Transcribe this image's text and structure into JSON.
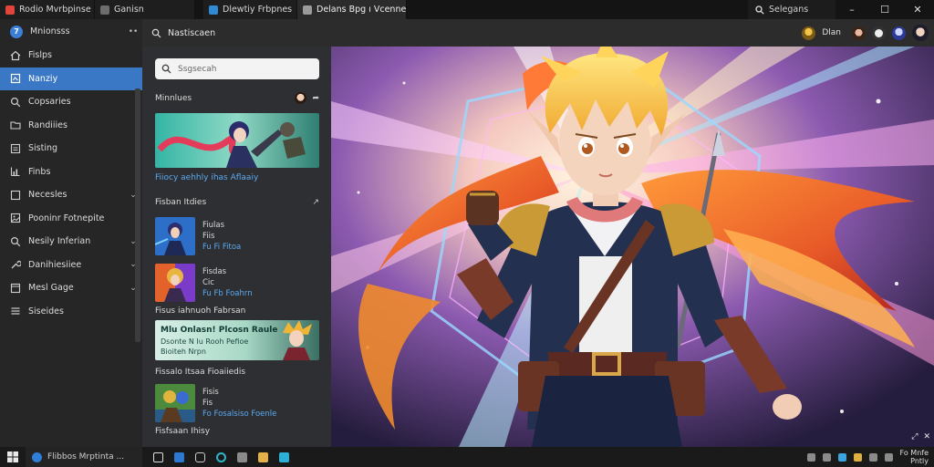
{
  "titlebar": {
    "tabs": [
      {
        "label": "Rodio Mvrbpinse",
        "color": "#e0443a"
      },
      {
        "label": "Ganisn",
        "color": "#6d6d6d"
      },
      {
        "label": "Dlewtiy Frbpnes",
        "color": "#2f8ad3"
      },
      {
        "label": "Delans Bpg ı Vcenne",
        "color": "#9a9a9a"
      }
    ],
    "search_label": "Selegans",
    "minimize": "–",
    "maximize": "☐",
    "close": "✕"
  },
  "sidebar": {
    "header": {
      "label": "Mnionsss",
      "avatar": "7"
    },
    "items": [
      {
        "label": "Fislps",
        "icon": "home-icon",
        "chevron": false
      },
      {
        "label": "Nanziy",
        "icon": "library-icon",
        "chevron": false,
        "active": true
      },
      {
        "label": "Copsaries",
        "icon": "search-icon",
        "chevron": false
      },
      {
        "label": "Randiiies",
        "icon": "folder-icon",
        "chevron": false
      },
      {
        "label": "Sisting",
        "icon": "list-icon",
        "chevron": false
      },
      {
        "label": "Finbs",
        "icon": "chart-icon",
        "chevron": false
      },
      {
        "label": "Necesles",
        "icon": "square-icon",
        "chevron": true
      },
      {
        "label": "Pooninr Fotnepite",
        "icon": "image-icon",
        "chevron": false
      },
      {
        "label": "Nesily Inferian",
        "icon": "search-icon",
        "chevron": true
      },
      {
        "label": "Danihiesiiee",
        "icon": "wrench-icon",
        "chevron": true
      },
      {
        "label": "Mesl Gage",
        "icon": "window-icon",
        "chevron": true
      },
      {
        "label": "Siseides",
        "icon": "menu-icon",
        "chevron": false
      }
    ]
  },
  "toolbar": {
    "back_label": "Nastiscaen",
    "user_label": "Dlan"
  },
  "midpanel": {
    "search_placeholder": "Ssgsecah",
    "section1": {
      "title": "Minnlues"
    },
    "banner_caption": "Fiiocy aehhly ihas Aflaaiy",
    "section2": {
      "title": "Fisban Itdies"
    },
    "items": [
      {
        "title": "Fiulas",
        "sub": "Fiis",
        "meta": "Fu Fi Fitoa"
      },
      {
        "title": "Fisdas",
        "sub": "Cic",
        "meta": "Fu Fb Foahrn"
      }
    ],
    "section3": {
      "title": "Fisus iahnuoh Fabrsan"
    },
    "promo": {
      "line1": "Mlu Onlasn! Plcosn Raule",
      "line2": "Dsonte N Iu Rooh Pefioe",
      "line3": "Bioiteh Nrpn"
    },
    "section4": {
      "title": "Fissalo Itsaa Fioaiiedis"
    },
    "item3": {
      "title": "Fisis",
      "sub": "Fis",
      "meta": "Fo Fosalsiso Foenle"
    },
    "section5": {
      "title": "Fisfsaan Ihisy"
    }
  },
  "hero": {
    "corner_label": "✕"
  },
  "taskbar": {
    "search_label": "Flibbos Mrptinta ..."
  },
  "tray": {
    "line1": "Fo Mnfe",
    "line2": "Pntly"
  }
}
